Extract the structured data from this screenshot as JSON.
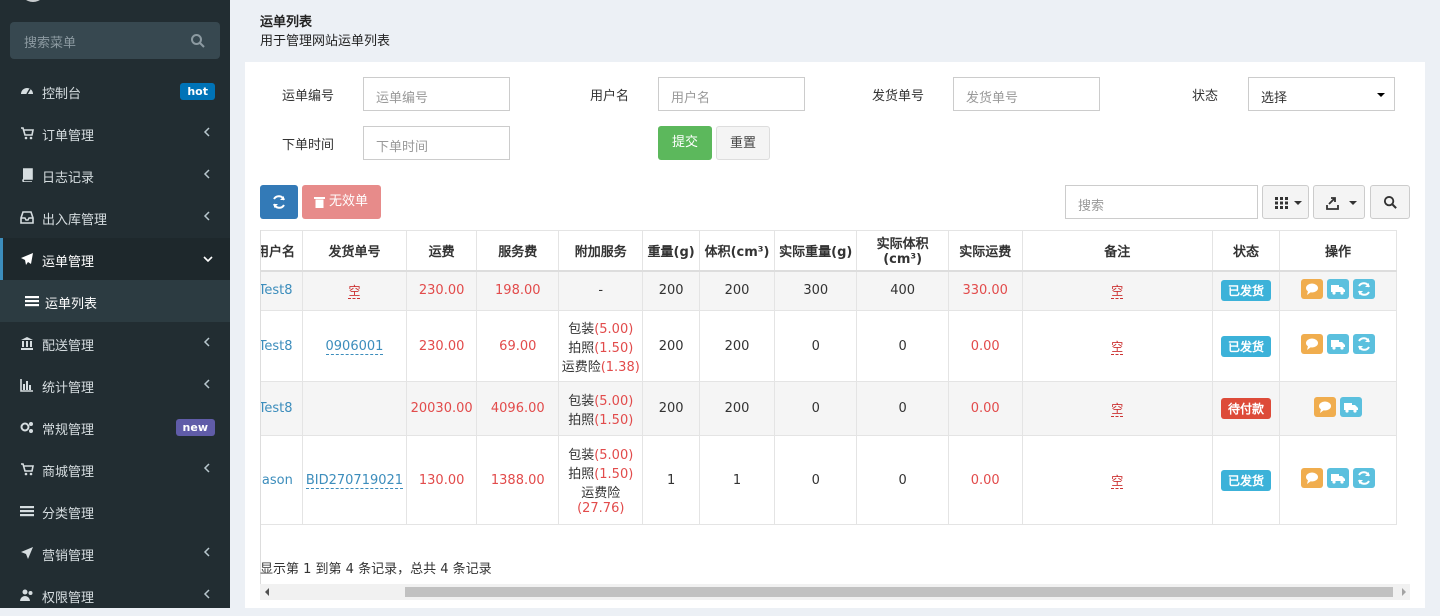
{
  "sidebar": {
    "search_placeholder": "搜索菜单",
    "items": [
      {
        "label": "控制台",
        "badge": "hot"
      },
      {
        "label": "订单管理"
      },
      {
        "label": "日志记录"
      },
      {
        "label": "出入库管理"
      },
      {
        "label": "运单管理"
      },
      {
        "label": "运单列表"
      },
      {
        "label": "配送管理"
      },
      {
        "label": "统计管理"
      },
      {
        "label": "常规管理",
        "badge": "new"
      },
      {
        "label": "商城管理"
      },
      {
        "label": "分类管理"
      },
      {
        "label": "营销管理"
      },
      {
        "label": "权限管理"
      }
    ]
  },
  "header": {
    "title": "运单列表",
    "subtitle": "用于管理网站运单列表"
  },
  "filters": {
    "waybill_label": "运单编号",
    "waybill_ph": "运单编号",
    "user_label": "用户名",
    "user_ph": "用户名",
    "ship_label": "发货单号",
    "ship_ph": "发货单号",
    "status_label": "状态",
    "status_value": "选择",
    "time_label": "下单时间",
    "time_ph": "下单时间",
    "submit": "提交",
    "reset": "重置"
  },
  "toolbar": {
    "invalid_label": "无效单",
    "search_ph": "搜索"
  },
  "table": {
    "headers": [
      "用户名",
      "发货单号",
      "运费",
      "服务费",
      "附加服务",
      "重量(g)",
      "体积(cm³)",
      "实际重量(g)",
      "实际体积(cm³)",
      "实际运费",
      "备注",
      "状态",
      "操作"
    ],
    "empty": "空",
    "rows": [
      {
        "user": "Test8",
        "ship": "",
        "fee": "230.00",
        "service": "198.00",
        "extra": "-",
        "weight": "200",
        "volume": "200",
        "aweight": "300",
        "avolume": "400",
        "afee": "330.00",
        "status": "已发货"
      },
      {
        "user": "Test8",
        "ship": "0906001",
        "fee": "230.00",
        "service": "69.00",
        "weight": "200",
        "volume": "200",
        "aweight": "0",
        "avolume": "0",
        "afee": "0.00",
        "status": "已发货",
        "svc": [
          {
            "n": "包装",
            "v": "(5.00)"
          },
          {
            "n": "拍照",
            "v": "(1.50)"
          },
          {
            "n": "运费险",
            "v": "(1.38)"
          }
        ]
      },
      {
        "user": "Test8",
        "ship": "",
        "fee": "20030.00",
        "service": "4096.00",
        "weight": "200",
        "volume": "200",
        "aweight": "0",
        "avolume": "0",
        "afee": "0.00",
        "status": "待付款",
        "svc": [
          {
            "n": "包装",
            "v": "(5.00)"
          },
          {
            "n": "拍照",
            "v": "(1.50)"
          }
        ]
      },
      {
        "user": "jason",
        "ship": "BID270719021",
        "fee": "130.00",
        "service": "1388.00",
        "weight": "1",
        "volume": "1",
        "aweight": "0",
        "avolume": "0",
        "afee": "0.00",
        "status": "已发货",
        "svc": [
          {
            "n": "包装",
            "v": "(5.00)"
          },
          {
            "n": "拍照",
            "v": "(1.50)"
          },
          {
            "n": "运费险",
            "v": "(27.76)"
          }
        ]
      }
    ]
  },
  "pager": {
    "text": "显示第 1 到第 4 条记录，总共 4 条记录"
  },
  "colors": {
    "sidebar": "#222d32",
    "accent": "#3c8dbc",
    "red": "#e24b4b",
    "green": "#5cb85c"
  }
}
